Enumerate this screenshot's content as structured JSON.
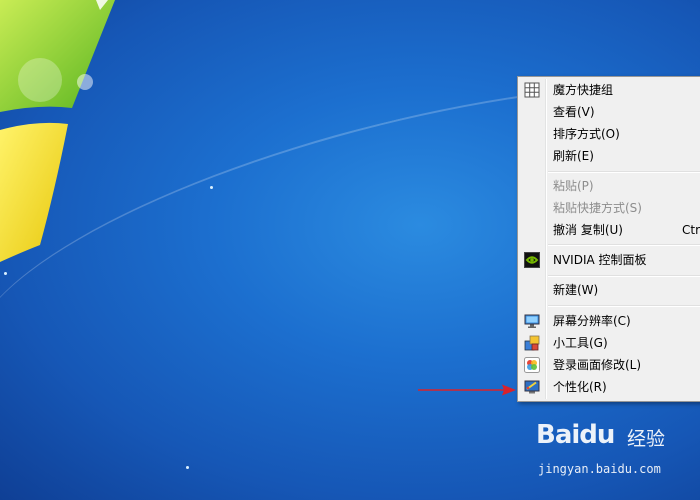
{
  "context_menu": {
    "items": [
      {
        "label": "魔方快捷组",
        "icon": "grid-icon",
        "enabled": true
      },
      {
        "label": "查看(V)",
        "enabled": true
      },
      {
        "label": "排序方式(O)",
        "enabled": true
      },
      {
        "label": "刷新(E)",
        "enabled": true
      },
      {
        "label": "粘贴(P)",
        "enabled": false
      },
      {
        "label": "粘贴快捷方式(S)",
        "enabled": false
      },
      {
        "label": "撤消 复制(U)",
        "shortcut": "Ctr",
        "enabled": true
      },
      {
        "label": "NVIDIA 控制面板",
        "icon": "nvidia-icon",
        "enabled": true
      },
      {
        "label": "新建(W)",
        "enabled": true
      },
      {
        "label": "屏幕分辨率(C)",
        "icon": "monitor-icon",
        "enabled": true
      },
      {
        "label": "小工具(G)",
        "icon": "gadgets-icon",
        "enabled": true
      },
      {
        "label": "登录画面修改(L)",
        "icon": "logon-icon",
        "enabled": true
      },
      {
        "label": "个性化(R)",
        "icon": "personalize-icon",
        "enabled": true
      }
    ]
  },
  "watermark": {
    "logo": "Baidu",
    "suffix": "经验",
    "url": "jingyan.baidu.com"
  },
  "colors": {
    "desktop": "#1c6fcf",
    "menu_bg": "#f0f0f0",
    "arrow": "#d9222a",
    "disabled_text": "#8d8d8d"
  }
}
